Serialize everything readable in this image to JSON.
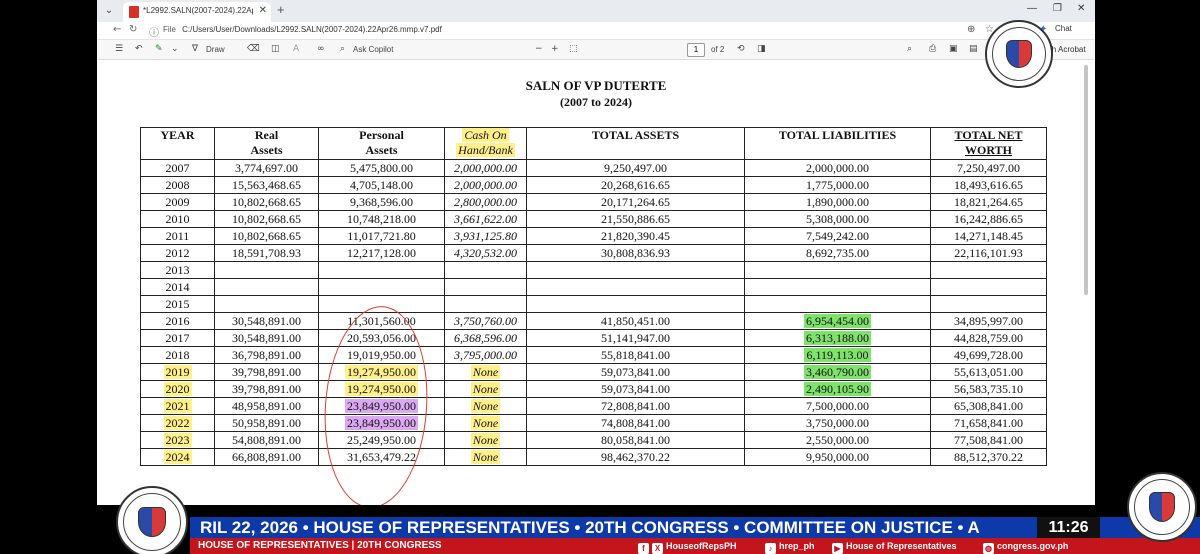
{
  "browser": {
    "tab_title": "*L2992.SALN(2007-2024).22Apr26.mmp.v7.pdf",
    "url_label": "File",
    "url": "C:/Users/User/Downloads/L2992.SALN(2007-2024).22Apr26.mmp.v7.pdf",
    "chat_label": "Chat"
  },
  "pdf_toolbar": {
    "draw_label": "Draw",
    "copilot_label": "Ask Copilot",
    "page_current": "1",
    "page_total": "of 2",
    "acrobat_label": "with Acrobat"
  },
  "document": {
    "title": "SALN OF VP DUTERTE",
    "subtitle": "(2007 to 2024)",
    "headers": {
      "year": "YEAR",
      "real_1": "Real",
      "real_2": "Assets",
      "personal_1": "Personal",
      "personal_2": "Assets",
      "cash_1": "Cash On",
      "cash_2": "Hand/Bank",
      "total_assets": "TOTAL ASSETS",
      "total_liabilities": "TOTAL LIABILITIES",
      "net_1": "TOTAL NET",
      "net_2": "WORTH"
    },
    "rows": [
      {
        "year": "2007",
        "real": "3,774,697.00",
        "personal": "5,475,800.00",
        "cash": "2,000,000.00",
        "assets": "9,250,497.00",
        "liabilities": "2,000,000.00",
        "net": "7,250,497.00"
      },
      {
        "year": "2008",
        "real": "15,563,468.65",
        "personal": "4,705,148.00",
        "cash": "2,000,000.00",
        "assets": "20,268,616.65",
        "liabilities": "1,775,000.00",
        "net": "18,493,616.65"
      },
      {
        "year": "2009",
        "real": "10,802,668.65",
        "personal": "9,368,596.00",
        "cash": "2,800,000.00",
        "assets": "20,171,264.65",
        "liabilities": "1,890,000.00",
        "net": "18,821,264.65"
      },
      {
        "year": "2010",
        "real": "10,802,668.65",
        "personal": "10,748,218.00",
        "cash": "3,661,622.00",
        "assets": "21,550,886.65",
        "liabilities": "5,308,000.00",
        "net": "16,242,886.65"
      },
      {
        "year": "2011",
        "real": "10,802,668.65",
        "personal": "11,017,721.80",
        "cash": "3,931,125.80",
        "assets": "21,820,390.45",
        "liabilities": "7,549,242.00",
        "net": "14,271,148.45"
      },
      {
        "year": "2012",
        "real": "18,591,708.93",
        "personal": "12,217,128.00",
        "cash": "4,320,532.00",
        "assets": "30,808,836.93",
        "liabilities": "8,692,735.00",
        "net": "22,116,101.93"
      },
      {
        "year": "2013",
        "real": "",
        "personal": "",
        "cash": "",
        "assets": "",
        "liabilities": "",
        "net": ""
      },
      {
        "year": "2014",
        "real": "",
        "personal": "",
        "cash": "",
        "assets": "",
        "liabilities": "",
        "net": ""
      },
      {
        "year": "2015",
        "real": "",
        "personal": "",
        "cash": "",
        "assets": "",
        "liabilities": "",
        "net": ""
      },
      {
        "year": "2016",
        "real": "30,548,891.00",
        "personal": "11,301,560.00",
        "cash": "3,750,760.00",
        "assets": "41,850,451.00",
        "liabilities": "6,954,454.00",
        "net": "34,895,997.00",
        "hl_liab": "g"
      },
      {
        "year": "2017",
        "real": "30,548,891.00",
        "personal": "20,593,056.00",
        "cash": "6,368,596.00",
        "assets": "51,141,947.00",
        "liabilities": "6,313,188.00",
        "net": "44,828,759.00",
        "hl_liab": "g"
      },
      {
        "year": "2018",
        "real": "36,798,891.00",
        "personal": "19,019,950.00",
        "cash": "3,795,000.00",
        "assets": "55,818,841.00",
        "liabilities": "6,119,113.00",
        "net": "49,699,728.00",
        "hl_liab": "g"
      },
      {
        "year": "2019",
        "real": "39,798,891.00",
        "personal": "19,274,950.00",
        "cash": "None",
        "assets": "59,073,841.00",
        "liabilities": "3,460,790.00",
        "net": "55,613,051.00",
        "hl_year": "y",
        "hl_personal": "y",
        "hl_cash": "y",
        "hl_liab": "g"
      },
      {
        "year": "2020",
        "real": "39,798,891.00",
        "personal": "19,274,950.00",
        "cash": "None",
        "assets": "59,073,841.00",
        "liabilities": "2,490,105.90",
        "net": "56,583,735.10",
        "hl_year": "y",
        "hl_personal": "y",
        "hl_cash": "y",
        "hl_liab": "g"
      },
      {
        "year": "2021",
        "real": "48,958,891.00",
        "personal": "23,849,950.00",
        "cash": "None",
        "assets": "72,808,841.00",
        "liabilities": "7,500,000.00",
        "net": "65,308,841.00",
        "hl_year": "y",
        "hl_personal": "p",
        "hl_cash": "y"
      },
      {
        "year": "2022",
        "real": "50,958,891.00",
        "personal": "23,849,950.00",
        "cash": "None",
        "assets": "74,808,841.00",
        "liabilities": "3,750,000.00",
        "net": "71,658,841.00",
        "hl_year": "y",
        "hl_personal": "p",
        "hl_cash": "y"
      },
      {
        "year": "2023",
        "real": "54,808,891.00",
        "personal": "25,249,950.00",
        "cash": "None",
        "assets": "80,058,841.00",
        "liabilities": "2,550,000.00",
        "net": "77,508,841.00",
        "hl_year": "y",
        "hl_cash": "y"
      },
      {
        "year": "2024",
        "real": "66,808,891.00",
        "personal": "31,653,479.22",
        "cash": "None",
        "assets": "98,462,370.22",
        "liabilities": "9,950,000.00",
        "net": "88,512,370.22",
        "hl_year": "y",
        "hl_cash": "y"
      }
    ]
  },
  "broadcast": {
    "ticker": "RIL 22, 2026 • HOUSE OF REPRESENTATIVES • 20TH CONGRESS • COMMITTEE ON JUSTICE • A",
    "clock": "11:26",
    "lower_left": "HOUSE OF REPRESENTATIVES  |  20TH CONGRESS",
    "social_fbx": "HouseofRepsPH",
    "social_tiktok": "hrep_ph",
    "social_youtube": "House of Representatives",
    "social_web": "congress.gov.ph",
    "seal_top": "HOUSE OF REPRESENTATIVES",
    "seal_bottom": "PHILIPPINES"
  },
  "colors": {
    "highlight_yellow": "#fff08a",
    "highlight_green": "#7fe36b",
    "highlight_purple": "#dca8f2",
    "pen_circle": "#e03a2a",
    "ticker_blue": "#0d3aa8",
    "lower_red": "#c4151c"
  }
}
